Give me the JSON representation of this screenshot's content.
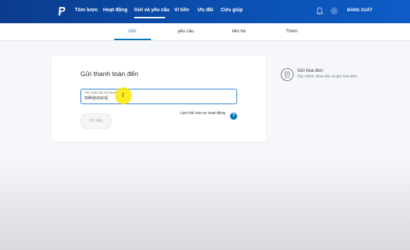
{
  "topnav": {
    "items": [
      "Tóm lược",
      "Hoạt động",
      "Gửi và yêu cầu",
      "Ví tiền",
      "Ưu đãi",
      "Cứu giúp"
    ],
    "logout": "ĐĂNG XUẤT"
  },
  "subnav": {
    "tabs": [
      "Gửi",
      "yêu cầu",
      "liên hệ",
      "Thêm"
    ],
    "active_tab": "Gửi"
  },
  "send_card": {
    "title": "Gửi thanh toán đến",
    "input_label": "Tên hoặc địa chỉ email",
    "input_value": "tole|ezxcs|",
    "help_link": "Làm thế nào nó hoạt động",
    "next_button": "Kế tiếp"
  },
  "invoice": {
    "title": "Gửi hóa đơn",
    "subtitle": "Tùy chỉnh, theo dõi và gửi hóa đơn."
  },
  "colors": {
    "brand_blue": "#0070ba",
    "topbar_dark": "#0b3c8c",
    "highlight": "#ffe600"
  }
}
